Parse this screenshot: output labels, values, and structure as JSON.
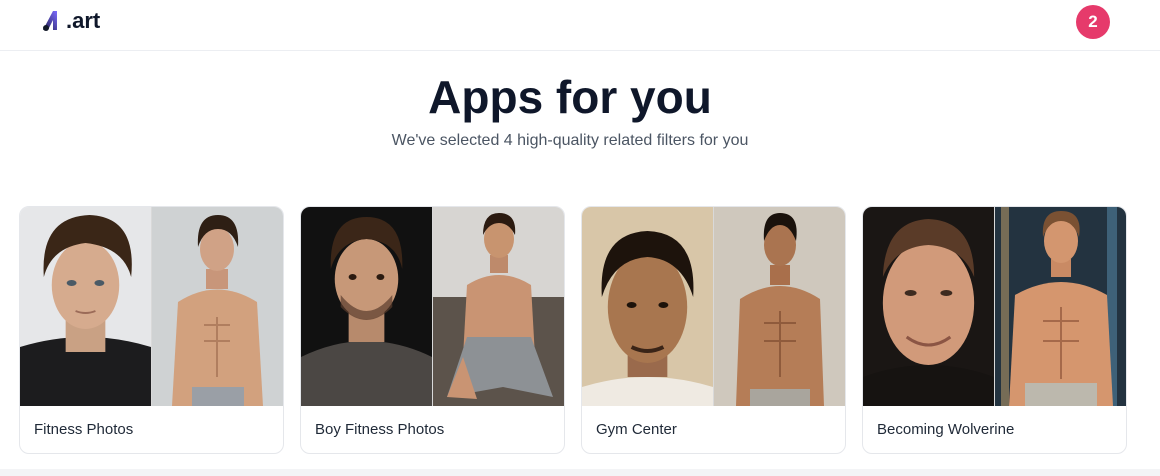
{
  "header": {
    "logo_text": ".art",
    "notification_count": "2"
  },
  "main": {
    "title": "Apps for you",
    "subtitle": "We've selected 4 high-quality related filters for you"
  },
  "cards": [
    {
      "label": "Fitness Photos"
    },
    {
      "label": "Boy Fitness Photos"
    },
    {
      "label": "Gym Center"
    },
    {
      "label": "Becoming Wolverine"
    }
  ],
  "colors": {
    "badge": "#e63a6b",
    "logo_gradient_start": "#1e1b4b",
    "logo_gradient_end": "#7c6cff"
  }
}
